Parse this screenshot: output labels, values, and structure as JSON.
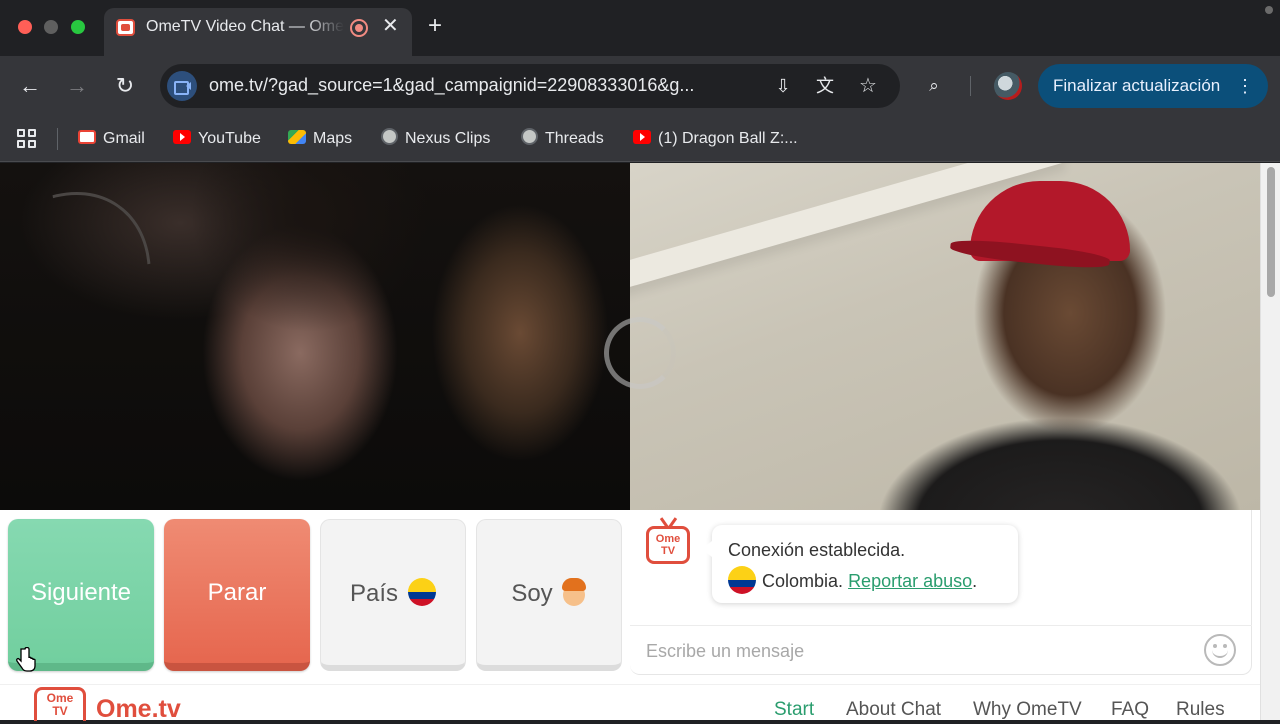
{
  "browser": {
    "tab": {
      "title": "OmeTV Video Chat — Omegle alternative",
      "close": "✕"
    },
    "new_tab": "+",
    "url": "ome.tv/?gad_source=1&gad_campaignid=22908333016&g...",
    "update_button": "Finalizar actualización",
    "icons": {
      "back": "←",
      "forward": "→",
      "reload": "↻",
      "install": "⇩",
      "translate": "文",
      "star": "☆",
      "lens": "⌕",
      "kebab": "⋮"
    },
    "bookmarks": [
      {
        "label": "Gmail"
      },
      {
        "label": "YouTube"
      },
      {
        "label": "Maps"
      },
      {
        "label": "Nexus Clips"
      },
      {
        "label": "Threads"
      },
      {
        "label": "(1) Dragon Ball Z:..."
      }
    ]
  },
  "controls": {
    "next": "Siguiente",
    "stop": "Parar",
    "country": "País",
    "gender": "Soy"
  },
  "chat": {
    "logo_text_top": "Ome",
    "logo_text_bottom": "TV",
    "status": "Conexión establecida.",
    "country": "Colombia.",
    "report": "Reportar abuso",
    "report_suffix": ".",
    "placeholder": "Escribe un mensaje"
  },
  "footer": {
    "logo_top": "Ome",
    "logo_bottom": "TV",
    "brand": "Ome.tv",
    "nav": [
      "Start",
      "About Chat",
      "Why OmeTV",
      "FAQ",
      "Rules"
    ]
  },
  "colors": {
    "next_button": "#72cf9f",
    "stop_button": "#e6674f",
    "brand_red": "#e04e3d",
    "link_green": "#2a9d6e",
    "update_button": "#0b4f7a"
  }
}
